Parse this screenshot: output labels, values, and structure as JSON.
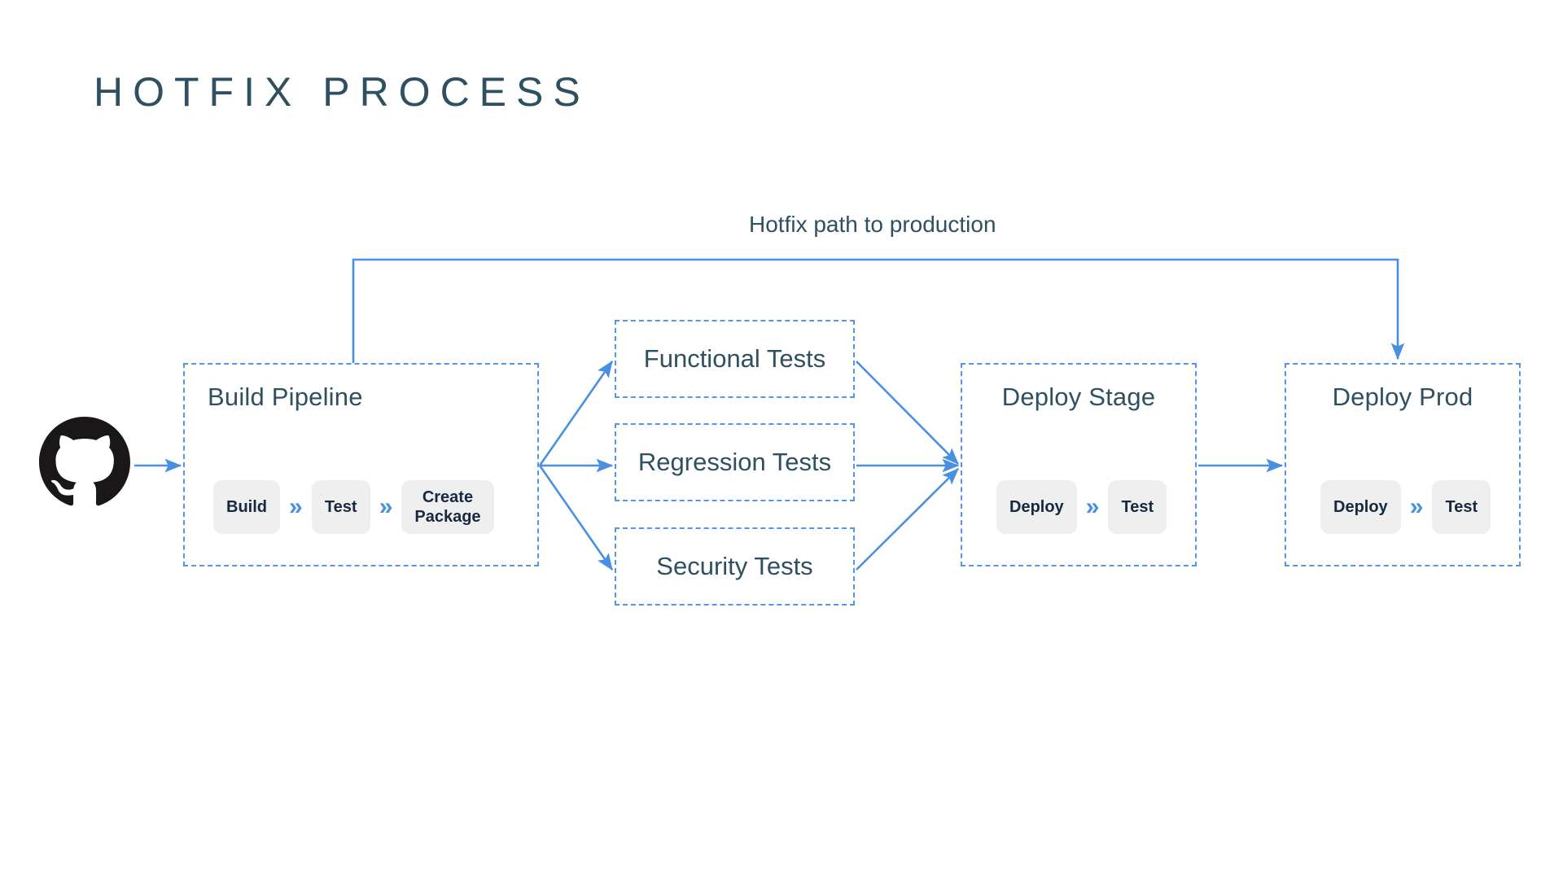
{
  "page": {
    "title": "HOTFIX PROCESS",
    "background_color": "#ffffff"
  },
  "colors": {
    "title_text": "#2f5060",
    "accent_blue": "#5596e6",
    "arrow_blue": "#4a90e2",
    "chip_background": "#efefef",
    "chip_text": "#16293f",
    "github_logo": "#191717"
  },
  "source": {
    "icon": "github-icon",
    "name": "GitHub"
  },
  "annotations": {
    "hotfix_path_label": "Hotfix path to production"
  },
  "stages": {
    "build_pipeline": {
      "title": "Build Pipeline",
      "steps": [
        {
          "label": "Build"
        },
        {
          "label": "Test"
        },
        {
          "label": "Create\nPackage"
        }
      ],
      "separator_icon": "double-chevron-right-icon"
    },
    "deploy_stage": {
      "title": "Deploy Stage",
      "steps": [
        {
          "label": "Deploy"
        },
        {
          "label": "Test"
        }
      ],
      "separator_icon": "double-chevron-right-icon"
    },
    "deploy_prod": {
      "title": "Deploy Prod",
      "steps": [
        {
          "label": "Deploy"
        },
        {
          "label": "Test"
        }
      ],
      "separator_icon": "double-chevron-right-icon"
    }
  },
  "test_stages": [
    {
      "label": "Functional Tests"
    },
    {
      "label": "Regression Tests"
    },
    {
      "label": "Security Tests"
    }
  ],
  "chevrons": {
    "glyph": "»"
  }
}
